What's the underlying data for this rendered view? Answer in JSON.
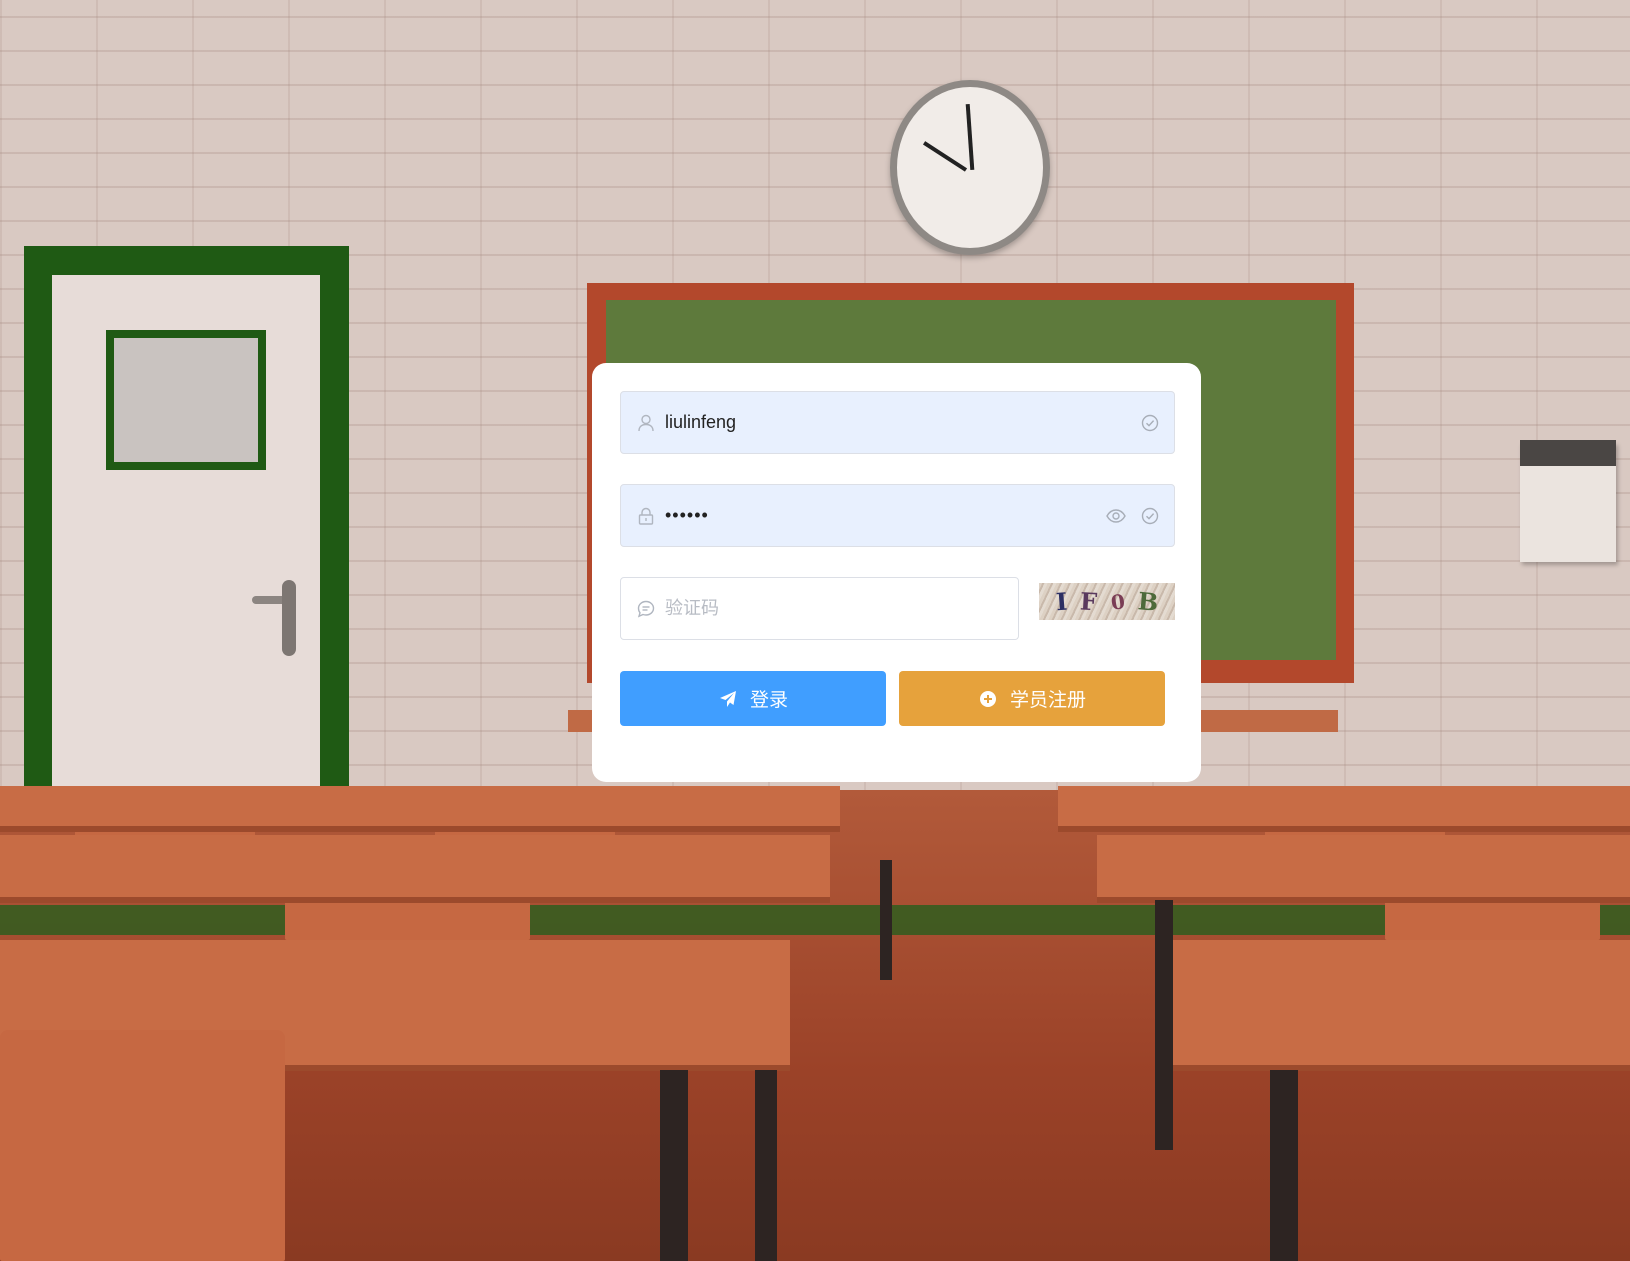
{
  "login_form": {
    "username": {
      "value": "liulinfeng",
      "leading_icon": "user-icon",
      "trailing_icon": "check-circle-icon"
    },
    "password": {
      "value": "••••••",
      "leading_icon": "lock-icon",
      "trailing_icons": [
        "eye-icon",
        "check-circle-icon"
      ]
    },
    "captcha": {
      "placeholder": "验证码",
      "value": "",
      "leading_icon": "message-icon",
      "image_chars": [
        "I",
        "F",
        "0",
        "B"
      ]
    },
    "buttons": {
      "login_label": "登录",
      "login_icon": "send-icon",
      "register_label": "学员注册",
      "register_icon": "circle-plus-icon"
    }
  },
  "colors": {
    "primary": "#409eff",
    "warning": "#e6a23c",
    "autofill_bg": "#e8f0fe",
    "card_bg": "#ffffff"
  },
  "background": {
    "scene": "classroom-background"
  }
}
